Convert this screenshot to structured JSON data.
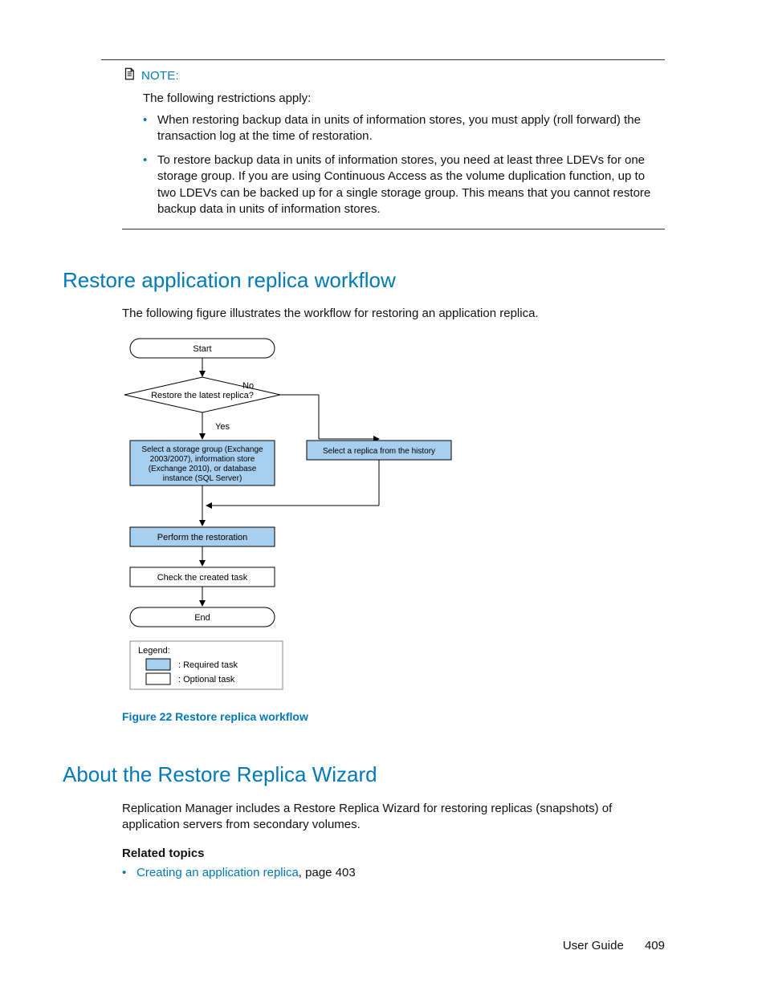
{
  "note": {
    "label": "NOTE:",
    "intro": "The following restrictions apply:",
    "items": [
      "When restoring backup data in units of information stores, you must apply (roll forward) the transaction log at the time of restoration.",
      "To restore backup data in units of information stores, you need at least three LDEVs for one storage group. If you are using Continuous Access as the volume duplication function, up to two LDEVs can be backed up for a single storage group. This means that you cannot restore backup data in units of information stores."
    ]
  },
  "section1": {
    "heading": "Restore application replica workflow",
    "intro": "The following figure illustrates the workflow for restoring an application replica.",
    "figure_caption": "Figure 22 Restore replica workflow"
  },
  "flow": {
    "start": "Start",
    "decision": "Restore the latest replica?",
    "yes": "Yes",
    "no": "No",
    "select_latest_l1": "Select a storage group (Exchange",
    "select_latest_l2": "2003/2007), information store",
    "select_latest_l3": "(Exchange 2010), or database",
    "select_latest_l4": "instance (SQL Server)",
    "select_history": "Select a replica from the history",
    "perform": "Perform the restoration",
    "check": "Check the created task",
    "end": "End",
    "legend_title": "Legend:",
    "legend_req": ": Required task",
    "legend_opt": ": Optional  task"
  },
  "section2": {
    "heading": "About the Restore Replica Wizard",
    "intro": "Replication Manager includes a Restore Replica Wizard for restoring replicas (snapshots) of application servers from secondary volumes.",
    "related_heading": "Related topics",
    "related_link": "Creating an application replica",
    "related_suffix": ", page 403"
  },
  "footer": {
    "label": "User Guide",
    "page": "409"
  }
}
